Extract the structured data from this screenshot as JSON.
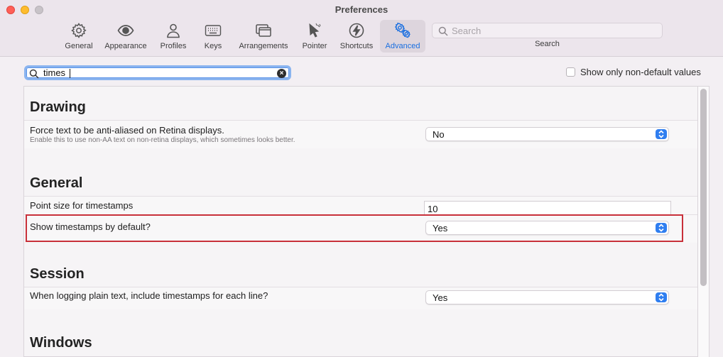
{
  "window": {
    "title": "Preferences"
  },
  "toolbar": {
    "tabs": [
      {
        "label": "General",
        "icon": "gear-icon"
      },
      {
        "label": "Appearance",
        "icon": "eye-icon"
      },
      {
        "label": "Profiles",
        "icon": "person-icon"
      },
      {
        "label": "Keys",
        "icon": "keyboard-icon"
      },
      {
        "label": "Arrangements",
        "icon": "windows-icon"
      },
      {
        "label": "Pointer",
        "icon": "cursor-icon"
      },
      {
        "label": "Shortcuts",
        "icon": "bolt-icon"
      },
      {
        "label": "Advanced",
        "icon": "gears-icon",
        "active": true
      }
    ],
    "search": {
      "placeholder": "Search",
      "label": "Search"
    }
  },
  "filter": {
    "value": "times",
    "non_default_label": "Show only non-default values",
    "non_default_checked": false
  },
  "sections": {
    "drawing": {
      "title": "Drawing",
      "antialias": {
        "label": "Force text to be anti-aliased on Retina displays.",
        "description": "Enable this to use non-AA text on non-retina displays, which sometimes looks better.",
        "value": "No"
      }
    },
    "general": {
      "title": "General",
      "timestamp_size": {
        "label": "Point size for timestamps",
        "value": "10"
      },
      "show_timestamps": {
        "label": "Show timestamps by default?",
        "value": "Yes"
      }
    },
    "session": {
      "title": "Session",
      "log_timestamps": {
        "label": "When logging plain text, include timestamps for each line?",
        "value": "Yes"
      }
    },
    "windows": {
      "title": "Windows"
    }
  },
  "colors": {
    "accent": "#1a6fe0",
    "highlight": "#c8303a"
  }
}
